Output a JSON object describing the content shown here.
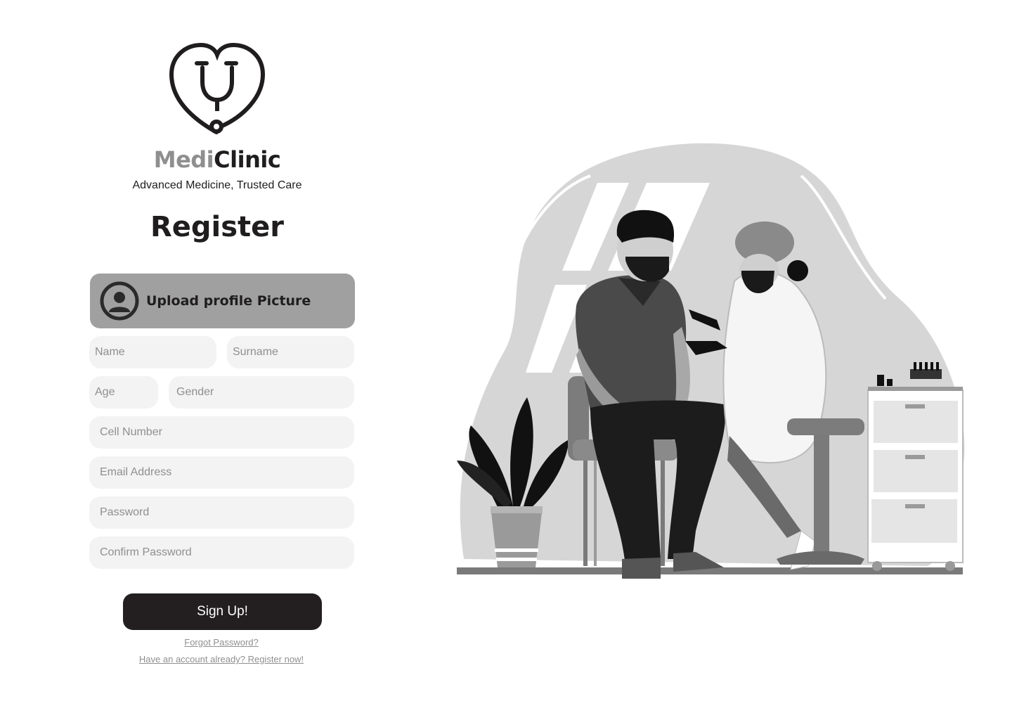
{
  "brand": {
    "name_part1": "Medi",
    "name_part2": "Clinic",
    "tagline": "Advanced Medicine, Trusted Care",
    "logo_icon": "heart-stethoscope-icon"
  },
  "form": {
    "title": "Register",
    "upload_label": "Upload profile Picture",
    "upload_icon": "user-avatar-icon",
    "fields": {
      "name": "Name",
      "surname": "Surname",
      "age": "Age",
      "gender": "Gender",
      "cell": "Cell Number",
      "email": "Email Address",
      "password": "Password",
      "confirm_password": "Confirm Password"
    },
    "submit_label": "Sign Up!",
    "forgot_link": "Forgot Password?",
    "account_link": "Have an account already? Register now!"
  },
  "colors": {
    "primary_dark": "#231f20",
    "accent_gray": "#8f8f8f",
    "upload_bg": "#a0a0a0",
    "field_bg": "#f3f3f3"
  }
}
